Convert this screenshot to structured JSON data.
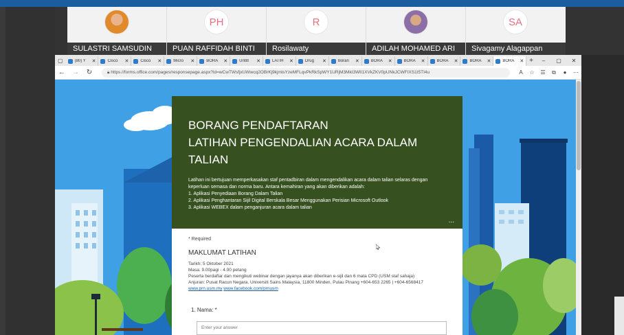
{
  "participants": [
    {
      "name": "SULASTRI SAMSUDIN",
      "initials": "",
      "type": "photo1"
    },
    {
      "name": "PUAN RAFFIDAH BINTI",
      "initials": "PH",
      "type": "initials"
    },
    {
      "name": "Rosilawaty",
      "initials": "R",
      "type": "initials"
    },
    {
      "name": "ADILAH MOHAMED ARI",
      "initials": "",
      "type": "photo2"
    },
    {
      "name": "Sivagamy Alagappan",
      "initials": "SA",
      "type": "initials"
    }
  ],
  "browser": {
    "tabs": [
      {
        "label": "(80) Y",
        "active": false
      },
      {
        "label": "Cisco",
        "active": false
      },
      {
        "label": "Cisco",
        "active": false
      },
      {
        "label": "Micro",
        "active": false
      },
      {
        "label": "BORA",
        "active": false
      },
      {
        "label": "Untitl",
        "active": false
      },
      {
        "label": "LATIH",
        "active": false
      },
      {
        "label": "Drug",
        "active": false
      },
      {
        "label": "Boran",
        "active": false
      },
      {
        "label": "BORA",
        "active": false
      },
      {
        "label": "BORA",
        "active": false
      },
      {
        "label": "BORA",
        "active": false
      },
      {
        "label": "BORA",
        "active": false
      },
      {
        "label": "BORA",
        "active": true
      }
    ],
    "url": "https://forms.office.com/pages/responsepage.aspx?id=wCwTWsfjxUWwcq2OBrKj9kjmisYzeMFLqvPkRkSpWY1URjM3MkI3WlI1XVkZKV0pUNkJCWFIXS1I5TI4u"
  },
  "form": {
    "title_line1": "BORANG PENDAFTARAN",
    "title_line2": "LATIHAN PENGENDALIAN ACARA DALAM",
    "title_line3": "TALIAN",
    "desc_line1": "Latihan ini bertujuan memperkasakan staf pentadbiran dalam mengendalikan acara dalam talian selaras dengan",
    "desc_line2": "keperluan semasa dan norma baru. Antara kemahiran yang akan diberikan adalah:",
    "desc_line3": "1. Aplikasi Penyediaan Borang Dalam Talian",
    "desc_line4": "2. Aplikasi Penghantaran Sijil Digital Berskala Besar Menggunakan Perisian Microsoft Outlook",
    "desc_line5": "3. Aplikasi WEBEX dalam penganjuran acara dalam talian",
    "more": "...",
    "required": "* Required",
    "section_title": "MAKLUMAT LATIHAN",
    "info_line1": "Tarikh: 5 Oktober 2021",
    "info_line2": "Masa: 9.00pagi - 4.00 petang",
    "info_line3": "Peserta berdaftar dan mengikuti webinar dengan jayanya akan diberikan e-sijil dan 6 mata CPD (USM staf sahaja)",
    "info_line4": "Anjuran: Pusat Racun Negara, Universiti Sains Malaysia, 11800 Minden, Pulau Pinang +604-653 2265 | +604-6568417",
    "link1": "www.prn.usm.my",
    "link2": "www.facebook.com/prnusm",
    "question1": "1. Nama: *",
    "answer_placeholder": "Enter your answer"
  }
}
